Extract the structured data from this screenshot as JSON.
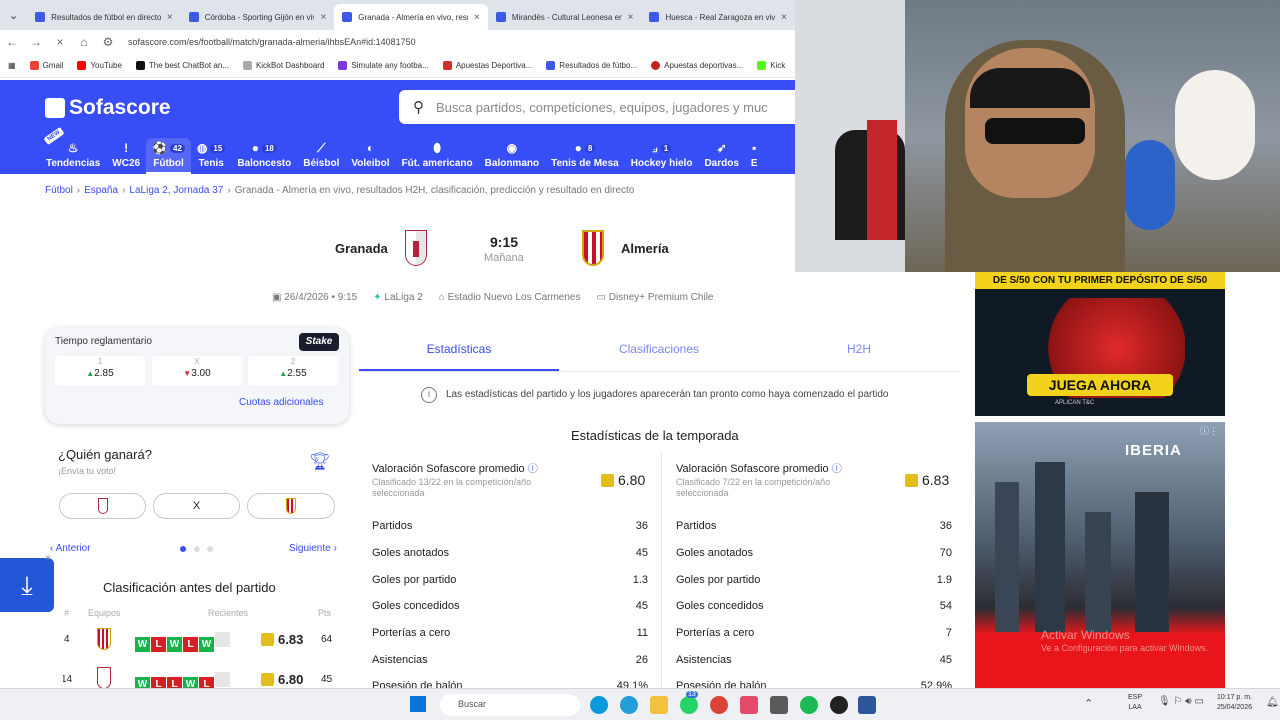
{
  "tabs": [
    {
      "title": "Resultados de fútbol en directo"
    },
    {
      "title": "Córdoba - Sporting Gijón en vivo"
    },
    {
      "title": "Granada - Almería en vivo, resu"
    },
    {
      "title": "Mirandés - Cultural Leonesa en"
    },
    {
      "title": "Huesca - Real Zaragoza en vivo"
    }
  ],
  "address": {
    "url": "sofascore.com/es/football/match/granada-almeria/ihbsEAn#id:14081750"
  },
  "bookmarks": [
    "Gmail",
    "YouTube",
    "The best ChatBot an...",
    "KickBot Dashboard",
    "Simulate any footba...",
    "Apuestas Deportiva...",
    "Resultados de fútbo...",
    "Apuestas deportivas...",
    "Kick"
  ],
  "header": {
    "logo": "Sofascore",
    "search_placeholder": "Busca partidos, competiciones, equipos, jugadores y muc"
  },
  "nav": [
    {
      "label": "Tendencias",
      "count": ""
    },
    {
      "label": "WC26",
      "count": ""
    },
    {
      "label": "Fútbol",
      "count": "42"
    },
    {
      "label": "Tenis",
      "count": "15"
    },
    {
      "label": "Baloncesto",
      "count": "18"
    },
    {
      "label": "Béisbol",
      "count": ""
    },
    {
      "label": "Voleibol",
      "count": ""
    },
    {
      "label": "Fút. americano",
      "count": ""
    },
    {
      "label": "Balonmano",
      "count": ""
    },
    {
      "label": "Tenis de Mesa",
      "count": "8"
    },
    {
      "label": "Hockey hielo",
      "count": "1"
    },
    {
      "label": "Dardos",
      "count": ""
    },
    {
      "label": "E",
      "count": ""
    }
  ],
  "nav_badge": "NEW",
  "breadcrumb": {
    "b1": "Fútbol",
    "b2": "España",
    "b3": "LaLiga 2, Jornada 37",
    "b4": "Granada - Almería en vivo, resultados H2H, clasificación, predicción y resultado en directo"
  },
  "match": {
    "home": "Granada",
    "away": "Almería",
    "time": "9:15",
    "day": "Mañana",
    "date": "26/4/2026 • 9:15",
    "league": "LaLiga 2",
    "stadium": "Estadio Nuevo Los Carmenes",
    "tv": "Disney+ Premium Chile"
  },
  "odds": {
    "title": "Tiempo reglamentario",
    "brand": "Stake",
    "o1k": "1",
    "o1": "2.85",
    "oxk": "X",
    "ox": "3.00",
    "o2k": "2",
    "o2": "2.55",
    "more": "Cuotas adicionales"
  },
  "vote": {
    "title": "¿Quién ganará?",
    "subtitle": "¡Envía tu voto!",
    "draw": "X",
    "prev": "Anterior",
    "next": "Siguiente"
  },
  "standings": {
    "title": "Clasificación antes del partido",
    "h_num": "#",
    "h_team": "Equipos",
    "h_recent": "Recientes",
    "h_pts": "Pts",
    "rows": [
      {
        "pos": "4",
        "rating": "6.83",
        "pts": "64"
      },
      {
        "pos": "14",
        "rating": "6.80",
        "pts": "45"
      }
    ]
  },
  "form_letters": {
    "w": "W",
    "l": "L"
  },
  "stats_tabs": [
    "Estadísticas",
    "Clasificaciones",
    "H2H"
  ],
  "info_text": "Las estadísticas del partido y los jugadores aparecerán tan pronto como haya comenzado el partido",
  "season": {
    "title": "Estadísticas de la temporada",
    "left": {
      "head": "Valoración Sofascore promedio",
      "sub": "Clasificado 13/22 en la competición/año seleccionada",
      "rating": "6.80"
    },
    "right": {
      "head": "Valoración Sofascore promedio",
      "sub": "Clasificado 7/22 en la competición/año seleccionada",
      "rating": "6.83"
    },
    "labels": [
      "Partidos",
      "Goles anotados",
      "Goles por partido",
      "Goles concedidos",
      "Porterías a cero",
      "Asistencias",
      "Posesión de balón"
    ],
    "lvals": [
      "36",
      "45",
      "1.3",
      "45",
      "11",
      "26",
      "49.1%"
    ],
    "rvals": [
      "36",
      "70",
      "1.9",
      "54",
      "7",
      "45",
      "52.9%"
    ]
  },
  "ads": {
    "ad1_top": "DE S/50 CON TU PRIMER DEPÓSITO DE S/50",
    "ad1_cta": "JUEGA AHORA",
    "ad1_small": "APLICAN T&C",
    "ad2_brand": "IBERIA",
    "watermark1": "Activar Windows",
    "watermark2": "Ve a Configuración para activar Windows."
  },
  "taskbar": {
    "search": "Buscar",
    "lang1": "ESP",
    "lang2": "LAA",
    "time": "10:17 p. m.",
    "date": "25/04/2026",
    "badge": "13"
  },
  "colors": {
    "brand": "#374df5",
    "win": "#18b24a",
    "loss": "#d41f23"
  }
}
